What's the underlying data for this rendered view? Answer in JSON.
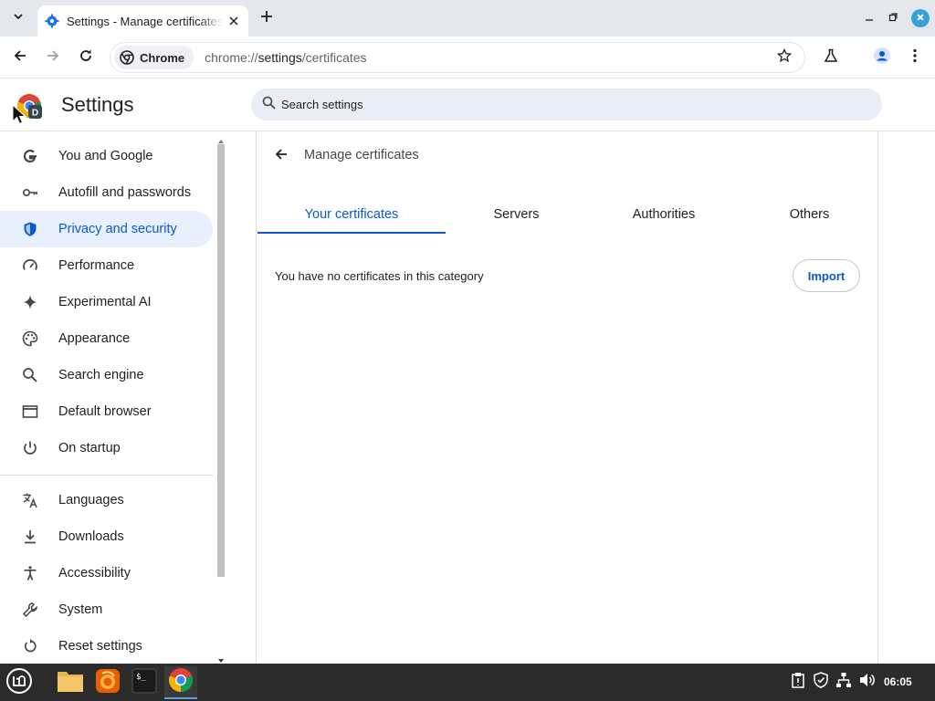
{
  "browser": {
    "tab_title": "Settings - Manage certificates",
    "omnibox_chip": "Chrome",
    "url_scheme": "chrome://",
    "url_host": "settings",
    "url_path": "/certificates"
  },
  "settings": {
    "title": "Settings",
    "search_placeholder": "Search settings"
  },
  "sidebar": {
    "items": [
      {
        "label": "You and Google",
        "icon": "google-icon"
      },
      {
        "label": "Autofill and passwords",
        "icon": "key-icon"
      },
      {
        "label": "Privacy and security",
        "icon": "shield-icon",
        "active": true
      },
      {
        "label": "Performance",
        "icon": "speedometer-icon"
      },
      {
        "label": "Experimental AI",
        "icon": "sparkle-icon"
      },
      {
        "label": "Appearance",
        "icon": "palette-icon"
      },
      {
        "label": "Search engine",
        "icon": "search-icon"
      },
      {
        "label": "Default browser",
        "icon": "browser-window-icon"
      },
      {
        "label": "On startup",
        "icon": "power-icon"
      },
      {
        "label": "Languages",
        "icon": "translate-icon"
      },
      {
        "label": "Downloads",
        "icon": "download-icon"
      },
      {
        "label": "Accessibility",
        "icon": "accessibility-icon"
      },
      {
        "label": "System",
        "icon": "wrench-icon"
      },
      {
        "label": "Reset settings",
        "icon": "reset-icon"
      }
    ]
  },
  "main": {
    "page_title": "Manage certificates",
    "tabs": [
      {
        "label": "Your certificates",
        "active": true
      },
      {
        "label": "Servers"
      },
      {
        "label": "Authorities"
      },
      {
        "label": "Others"
      }
    ],
    "empty_message": "You have no certificates in this category",
    "import_label": "Import"
  },
  "taskbar": {
    "clock": "06:05"
  },
  "colors": {
    "accent": "#0b57d0",
    "active_nav_bg": "#e8f0fe",
    "search_bg": "#e9eef6",
    "taskbar_bg": "#2b2b2b"
  }
}
